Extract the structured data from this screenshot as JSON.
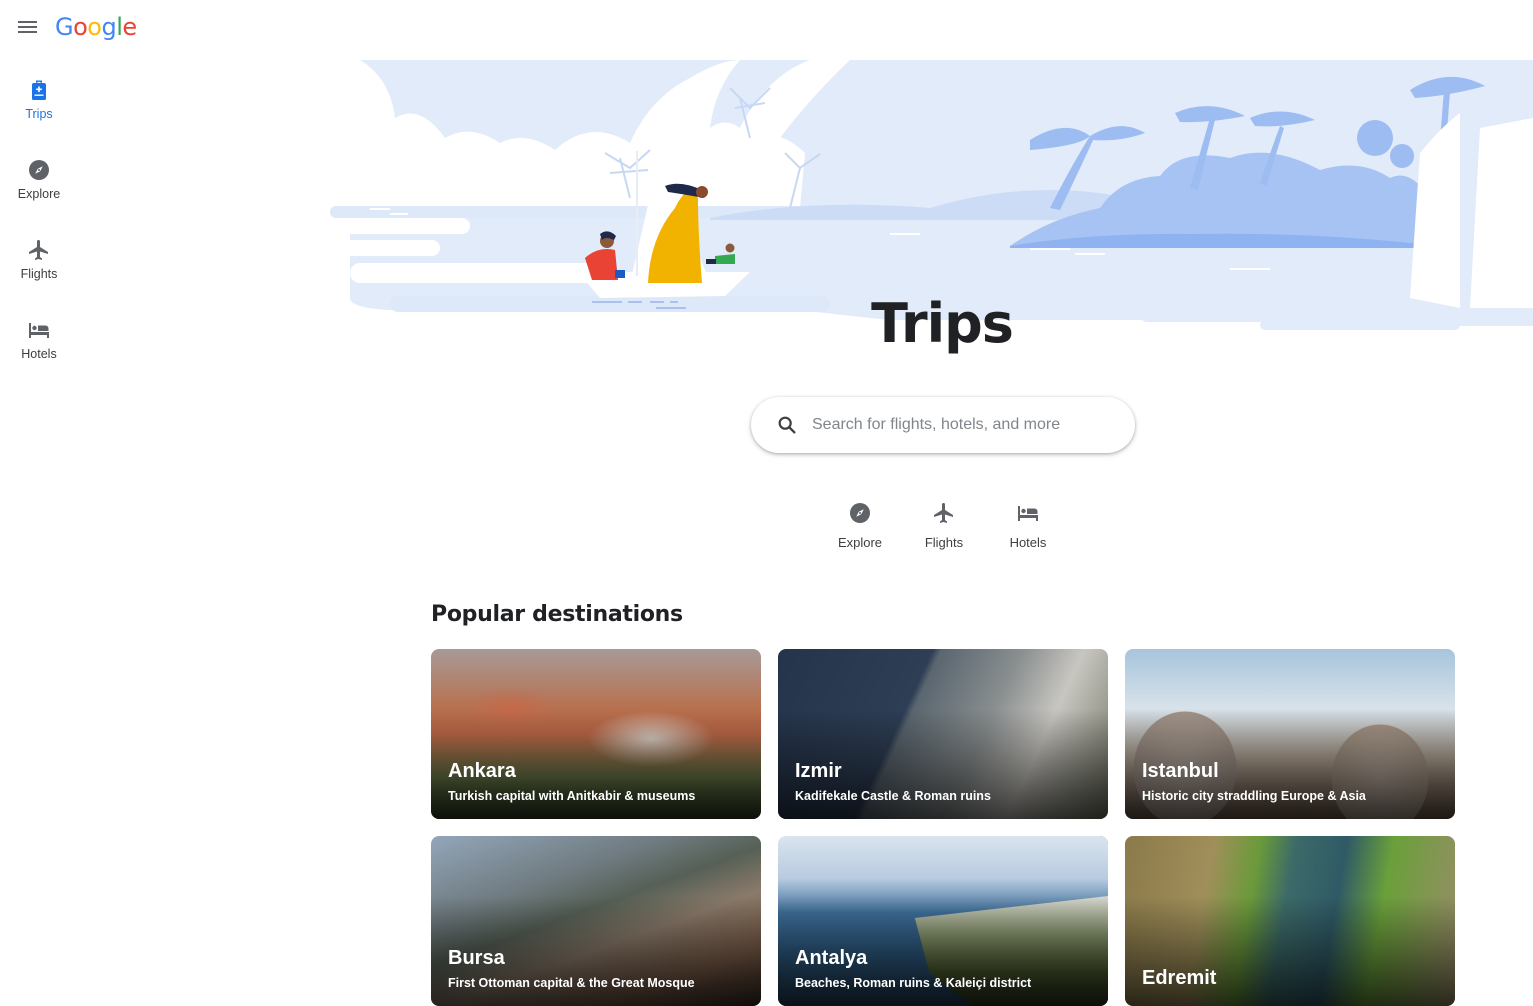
{
  "header": {
    "menu_icon": "hamburger-menu-icon",
    "logo_text": [
      "G",
      "o",
      "o",
      "g",
      "l",
      "e"
    ]
  },
  "rail": {
    "items": [
      {
        "label": "Trips",
        "icon": "backpack-icon",
        "active": true
      },
      {
        "label": "Explore",
        "icon": "compass-icon",
        "active": false
      },
      {
        "label": "Flights",
        "icon": "airplane-icon",
        "active": false
      },
      {
        "label": "Hotels",
        "icon": "bed-icon",
        "active": false
      }
    ]
  },
  "main": {
    "title": "Trips",
    "search": {
      "placeholder": "Search for flights, hotels, and more",
      "value": "",
      "icon": "search-icon"
    },
    "quick_links": [
      {
        "label": "Explore",
        "icon": "compass-icon"
      },
      {
        "label": "Flights",
        "icon": "airplane-icon"
      },
      {
        "label": "Hotels",
        "icon": "bed-icon"
      }
    ],
    "popular": {
      "title": "Popular destinations",
      "destinations": [
        {
          "name": "Ankara",
          "description": "Turkish capital with Anitkabir & museums"
        },
        {
          "name": "Izmir",
          "description": "Kadifekale Castle & Roman ruins"
        },
        {
          "name": "Istanbul",
          "description": "Historic city straddling Europe & Asia"
        },
        {
          "name": "Bursa",
          "description": "First Ottoman capital & the Great Mosque"
        },
        {
          "name": "Antalya",
          "description": "Beaches, Roman ruins & Kaleiçi district"
        },
        {
          "name": "Edremit",
          "description": ""
        }
      ]
    }
  },
  "colors": {
    "accent": "#1a73e8",
    "icon_gray": "#5f6368",
    "hero_sky": "#e0eafa",
    "hero_island": "#a7c3f4"
  }
}
